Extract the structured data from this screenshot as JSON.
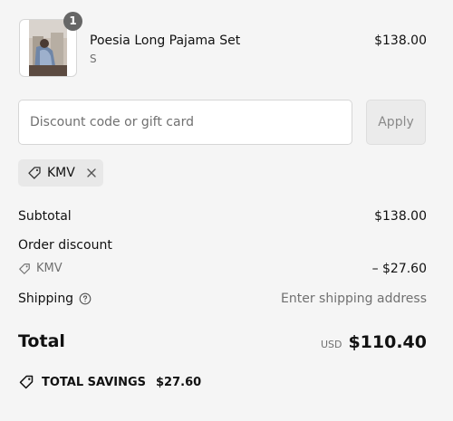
{
  "product": {
    "name": "Poesia Long Pajama Set",
    "variant": "S",
    "price": "$138.00",
    "quantity": "1"
  },
  "discount": {
    "placeholder": "Discount code or gift card",
    "apply_label": "Apply",
    "applied_code": "KMV"
  },
  "summary": {
    "subtotal_label": "Subtotal",
    "subtotal_value": "$138.00",
    "order_discount_label": "Order discount",
    "discount_code": "KMV",
    "discount_value": "– $27.60",
    "shipping_label": "Shipping",
    "shipping_value": "Enter shipping address",
    "total_label": "Total",
    "currency": "USD",
    "total_value": "$110.40",
    "savings_label": "TOTAL SAVINGS",
    "savings_value": "$27.60"
  },
  "icons": {
    "discount": "tag-icon",
    "remove": "close-icon",
    "shipping_info": "info-icon",
    "savings": "tag-icon"
  },
  "colors": {
    "background": "#f5f5f5",
    "text": "#111111",
    "muted": "#707070",
    "badge": "#666666"
  }
}
